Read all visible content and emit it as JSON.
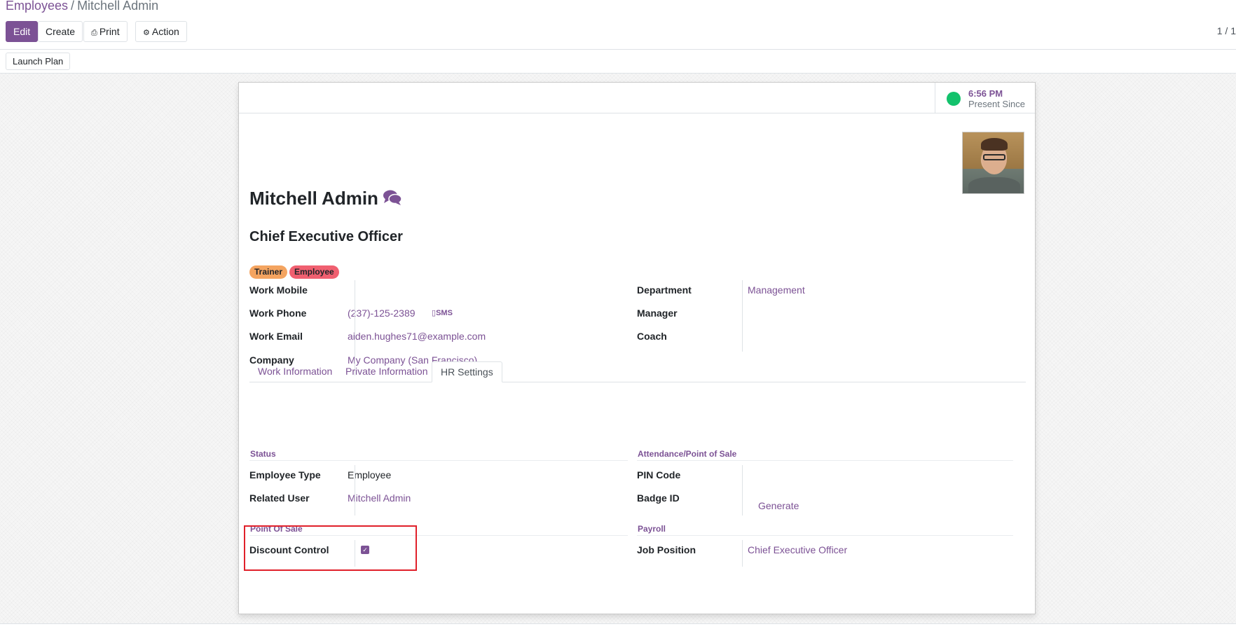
{
  "breadcrumb": {
    "parent": "Employees",
    "separator": "/",
    "current": "Mitchell Admin"
  },
  "toolbar": {
    "edit_label": "Edit",
    "create_label": "Create",
    "print_label": "Print",
    "action_label": "Action",
    "pager": "1 / 1"
  },
  "statusbar": {
    "launch_plan_label": "Launch Plan"
  },
  "presence": {
    "time": "6:56 PM",
    "label": "Present Since",
    "color": "#13c26c"
  },
  "employee": {
    "name": "Mitchell Admin",
    "job_title": "Chief Executive Officer",
    "tags": [
      {
        "label": "Trainer",
        "color": "#f4a460"
      },
      {
        "label": "Employee",
        "color": "#f06070"
      }
    ]
  },
  "contact": {
    "work_mobile_label": "Work Mobile",
    "work_mobile": "",
    "work_phone_label": "Work Phone",
    "work_phone": "(237)-125-2389",
    "sms_label": "SMS",
    "work_email_label": "Work Email",
    "work_email": "aiden.hughes71@example.com",
    "company_label": "Company",
    "company": "My Company (San Francisco)",
    "department_label": "Department",
    "department": "Management",
    "manager_label": "Manager",
    "manager": "",
    "coach_label": "Coach",
    "coach": ""
  },
  "tabs": [
    {
      "label": "Work Information",
      "active": false
    },
    {
      "label": "Private Information",
      "active": false
    },
    {
      "label": "HR Settings",
      "active": true
    }
  ],
  "hr_settings": {
    "status_title": "Status",
    "employee_type_label": "Employee Type",
    "employee_type": "Employee",
    "related_user_label": "Related User",
    "related_user": "Mitchell Admin",
    "pos_title": "Point Of Sale",
    "discount_control_label": "Discount Control",
    "discount_control_checked": true,
    "attendance_title": "Attendance/Point of Sale",
    "pin_code_label": "PIN Code",
    "pin_code": "",
    "badge_id_label": "Badge ID",
    "generate_label": "Generate",
    "payroll_title": "Payroll",
    "job_position_label": "Job Position",
    "job_position": "Chief Executive Officer"
  },
  "colors": {
    "primary": "#7c5295",
    "highlight": "#e0202a"
  }
}
